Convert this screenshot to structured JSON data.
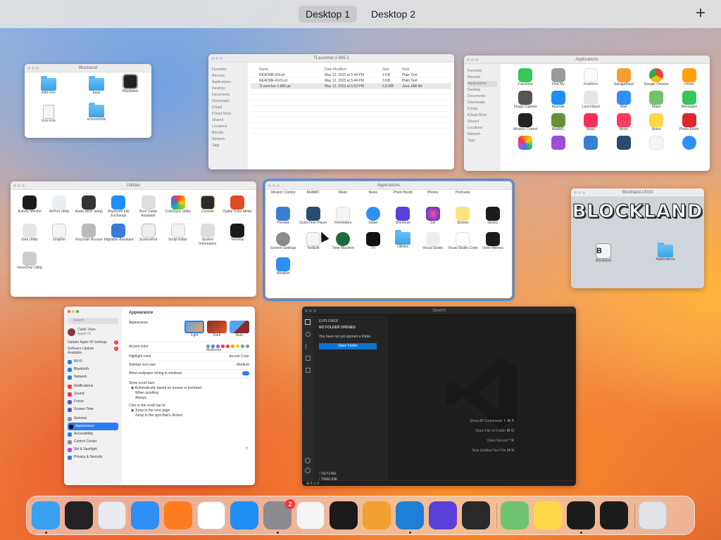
{
  "spaces": {
    "tabs": [
      {
        "label": "Desktop 1"
      },
      {
        "label": "Desktop 2"
      }
    ],
    "add": "+"
  },
  "windows": {
    "blockland_finder": {
      "title": "Blockland",
      "items": [
        {
          "label": "Add-Ons",
          "icon": "folder-icon"
        },
        {
          "label": "base",
          "icon": "folder-icon"
        },
        {
          "label": "Blockland",
          "icon": "blockland-app-icon"
        },
        {
          "label": "Icon.icns",
          "icon": "file-icon"
        },
        {
          "label": "screenshots",
          "icon": "folder-icon"
        }
      ]
    },
    "tlauncher_finder": {
      "title": "TLauncher-2.885 2",
      "sidebar": [
        "Favorites",
        "Recents",
        "Applications",
        "Desktop",
        "Documents",
        "Downloads",
        "iCloud",
        "iCloud Drive",
        "Shared",
        "Locations",
        "Blockla...",
        "Network",
        "Tags"
      ],
      "columns": [
        "Name",
        "Date Modified",
        "Size",
        "Kind"
      ],
      "rows": [
        [
          "README-EN.txt",
          "May 12, 2023 at 5:44 PM",
          "2 KB",
          "Plain Text"
        ],
        [
          "README-RUS.txt",
          "May 12, 2023 at 5:44 PM",
          "3 KB",
          "Plain Text"
        ],
        [
          "TLauncher-2.885.jar",
          "May 12, 2023 at 5:53 PM",
          "6.9 MB",
          "Java JAR file"
        ]
      ]
    },
    "applications_finder": {
      "title": "Applications",
      "sidebar": [
        "Favorites",
        "Recents",
        "Applications",
        "Desktop",
        "Documents",
        "Downloads",
        "iCloud",
        "iCloud Drive",
        "Shared",
        "Locations",
        "Network",
        "Tags"
      ],
      "apps": [
        "Facetime",
        "Find My",
        "Freeform",
        "GarageBand",
        "Google Chrome",
        "Home",
        "Image Capture",
        "Keynote",
        "Launchpad",
        "Mail",
        "Maps",
        "Messages",
        "Mission Control",
        "MultiMC",
        "Music",
        "News",
        "Notes",
        "Photo Booth",
        "Photos",
        "Podcasts",
        "Preview",
        "QuickTime",
        "Reminders",
        "Safari"
      ]
    },
    "utilities": {
      "title": "Utilities",
      "apps": [
        "Activity Monitor",
        "AirPort Utility",
        "Audio MIDI Setup",
        "Bluetooth File Exchange",
        "Boot Camp Assistant",
        "ColorSync Utility",
        "Console",
        "Digital Color Meter",
        "Disk Utility",
        "Grapher",
        "Keychain Access",
        "Migration Assistant",
        "Screenshot",
        "Script Editor",
        "System Information",
        "Terminal",
        "VoiceOver Utility"
      ]
    },
    "applications_selected": {
      "title": "Applications",
      "top_row": [
        "Mission Control",
        "MultiMC",
        "Music",
        "News",
        "Photo Booth",
        "Photos",
        "Podcasts"
      ],
      "apps": [
        "Preview",
        "QuickTime Player",
        "Reminders",
        "Safari",
        "Shortcuts",
        "Siri",
        "Stickies",
        "Stocks",
        "System Settings",
        "TextEdit",
        "Time Machine",
        "TV",
        "Utilities",
        "Visual Studio",
        "Visual Studio Code",
        "Voice Memos",
        "Weather"
      ]
    },
    "blockland_dmg": {
      "title": "Blockland-r2033",
      "banner": "BLOCKLAND",
      "items": [
        {
          "label": "Blockland"
        },
        {
          "label": "Applications"
        }
      ]
    },
    "settings": {
      "header": "Appearance",
      "search_placeholder": "Search",
      "user_name": "Caleb Vlanr",
      "user_sub": "Apple ID",
      "notices": [
        {
          "label": "Update Apple ID Settings",
          "badge": "1"
        },
        {
          "label": "Software Update Available",
          "badge": "1"
        }
      ],
      "sidebar": [
        {
          "label": "Wi-Fi",
          "color": "#2f7bf5"
        },
        {
          "label": "Bluetooth",
          "color": "#2f7bf5"
        },
        {
          "label": "Network",
          "color": "#2f7bf5"
        },
        {
          "label": "Notifications",
          "color": "#ff3b30"
        },
        {
          "label": "Sound",
          "color": "#ff2d55"
        },
        {
          "label": "Focus",
          "color": "#5856d6"
        },
        {
          "label": "Screen Time",
          "color": "#5856d6"
        },
        {
          "label": "General",
          "color": "#8e8e93"
        },
        {
          "label": "Appearance",
          "color": "#111111"
        },
        {
          "label": "Accessibility",
          "color": "#2f7bf5"
        },
        {
          "label": "Control Center",
          "color": "#8e8e93"
        },
        {
          "label": "Siri & Spotlight",
          "color": "#af52de"
        },
        {
          "label": "Privacy & Security",
          "color": "#2f7bf5"
        }
      ],
      "active_item": "Appearance",
      "appearance_label": "Appearance",
      "modes": [
        "Light",
        "Dark",
        "Auto"
      ],
      "accent_label": "Accent color",
      "accent_sub": "Multicolor",
      "accent_colors": [
        "#8e8e93",
        "#2f7bf5",
        "#af52de",
        "#ff2d55",
        "#ff3b30",
        "#ff9500",
        "#ffcc00",
        "#34c759",
        "#8e8e93"
      ],
      "highlight_label": "Highlight color",
      "highlight_value": "Accent Color",
      "sidebar_icon_label": "Sidebar icon size",
      "sidebar_icon_value": "Medium",
      "tinting_label": "Allow wallpaper tinting in windows",
      "scroll_label": "Show scroll bars",
      "scroll_options": [
        "Automatically based on mouse or trackpad",
        "When scrolling",
        "Always"
      ],
      "click_label": "Click in the scroll bar to",
      "click_options": [
        "Jump to the next page",
        "Jump to the spot that's clicked"
      ],
      "help": "?"
    },
    "vscode": {
      "title": "Search",
      "explorer": "EXPLORER",
      "no_folder": "NO FOLDER OPENED",
      "message": "You have not yet opened a folder.",
      "open_folder": "Open Folder",
      "hints": [
        {
          "label": "Show All Commands",
          "keys": "⇧ ⌘ P"
        },
        {
          "label": "Open File or Folder",
          "keys": "⌘ O"
        },
        {
          "label": "Open Recent",
          "keys": "^ R"
        },
        {
          "label": "New Untitled Text File",
          "keys": "⌘ N"
        }
      ],
      "outline": "OUTLINE",
      "timeline": "TIMELINE",
      "status": "⊗ 0 ⚠ 0"
    }
  },
  "dock": {
    "apps": [
      {
        "name": "Finder",
        "color": "#3aa0f0",
        "running": true
      },
      {
        "name": "Mission Control",
        "color": "#222222",
        "running": false
      },
      {
        "name": "Launchpad",
        "color": "#e9e9ef",
        "running": false
      },
      {
        "name": "Safari",
        "color": "#2f8ff5",
        "running": false
      },
      {
        "name": "Firefox",
        "color": "#ff7b1f",
        "running": false
      },
      {
        "name": "Google Chrome",
        "color": "#ffffff",
        "running": false
      },
      {
        "name": "App Store",
        "color": "#1f8ef5",
        "running": false
      },
      {
        "name": "System Settings",
        "color": "#8a8a8f",
        "running": true,
        "badge": "2"
      },
      {
        "name": "TextEdit",
        "color": "#f5f5f5",
        "running": false
      },
      {
        "name": "Terminal",
        "color": "#1a1a1a",
        "running": false
      },
      {
        "name": "GarageBand",
        "color": "#f0a030",
        "running": false
      },
      {
        "name": "Visual Studio Code",
        "color": "#1e7fd6",
        "running": true
      },
      {
        "name": "Shortcuts",
        "color": "#5b3fd9",
        "running": false
      },
      {
        "name": "Console",
        "color": "#2a2a2a",
        "running": false
      },
      {
        "name": "Maps",
        "color": "#6fc36f",
        "running": false
      },
      {
        "name": "Notes",
        "color": "#ffd84a",
        "running": false
      },
      {
        "name": "Activity Monitor",
        "color": "#1c1c1c",
        "running": true
      },
      {
        "name": "Activity Monitor (minimized)",
        "color": "#1c1c1c",
        "running": false
      },
      {
        "name": "Trash",
        "color": "#dfe3e8",
        "running": false
      }
    ]
  }
}
